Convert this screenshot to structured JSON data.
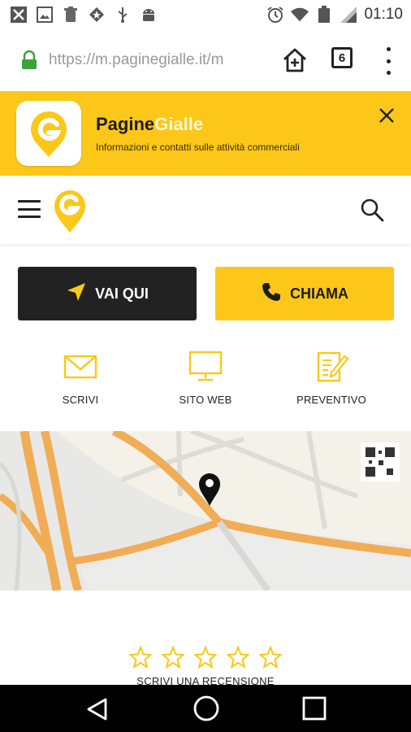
{
  "status_bar": {
    "time": "01:10",
    "icons": [
      "close-box-icon",
      "image-icon",
      "recycle-icon",
      "star-badge-icon",
      "usb-icon",
      "android-icon",
      "alarm-icon",
      "wifi-icon",
      "battery-icon",
      "signal-icon"
    ]
  },
  "browser": {
    "url": "https://m.paginegialle.it/m",
    "tab_count": "6",
    "icons": [
      "lock-icon",
      "home-plus-icon",
      "tabs-icon",
      "more-vertical-icon"
    ]
  },
  "app_banner": {
    "name_part1": "Pagine",
    "name_part2": "Gialle",
    "subtitle": "Informazioni e contatti sulle attività commerciali",
    "close_icon": "close-icon"
  },
  "site_header": {
    "menu_icon": "menu-icon",
    "logo_icon": "pg-pin-logo-icon",
    "search_icon": "search-icon"
  },
  "cta": {
    "go_label": "VAI QUI",
    "call_label": "CHIAMA"
  },
  "actions": [
    {
      "label": "SCRIVI",
      "icon": "envelope-icon"
    },
    {
      "label": "SITO WEB",
      "icon": "monitor-icon"
    },
    {
      "label": "PREVENTIVO",
      "icon": "edit-form-icon"
    }
  ],
  "review": {
    "stars": 5,
    "filled": 0,
    "label": "SCRIVI UNA RECENSIONE"
  },
  "colors": {
    "brand_yellow": "#fcc718",
    "dark": "#222222",
    "map_road": "#f0ad55"
  },
  "android_nav": {
    "icons": [
      "back-icon",
      "home-icon",
      "recents-icon"
    ]
  }
}
